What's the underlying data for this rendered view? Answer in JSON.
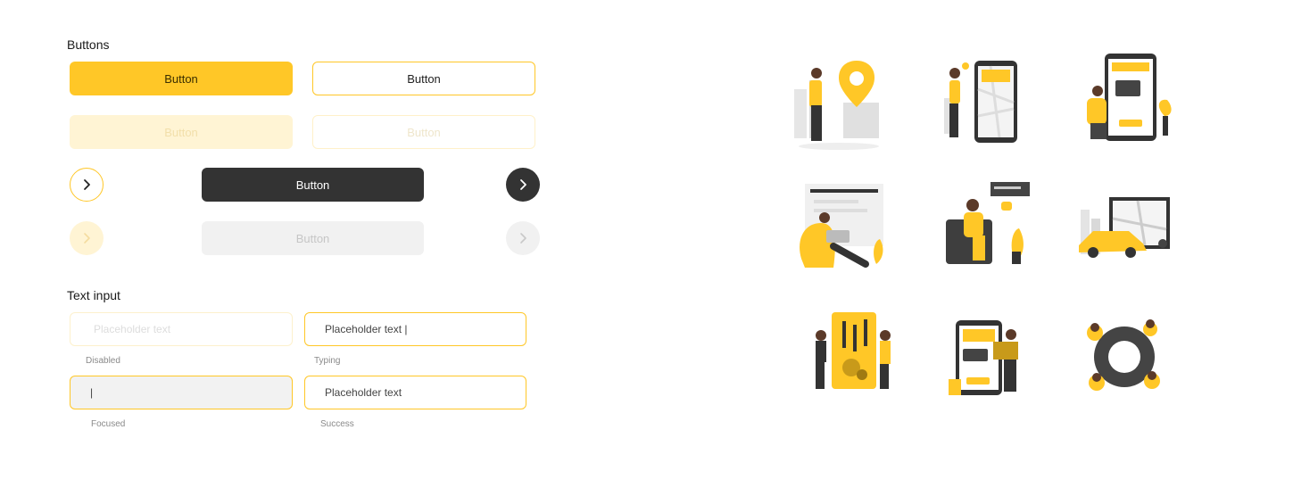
{
  "sections": {
    "buttons_title": "Buttons",
    "text_input_title": "Text input"
  },
  "buttons": {
    "primary": "Button",
    "outline": "Button",
    "primary_disabled": "Button",
    "outline_disabled": "Button",
    "dark": "Button",
    "dark_disabled": "Button"
  },
  "inputs": {
    "disabled": {
      "value": "Placeholder text",
      "caption": "Disabled"
    },
    "typing": {
      "value": "Placeholder text |",
      "caption": "Typing"
    },
    "focused": {
      "value": "|",
      "caption": "Focused"
    },
    "success": {
      "value": "Placeholder text",
      "caption": "Success"
    }
  },
  "icons": [
    "chevron-right-icon"
  ],
  "colors": {
    "accent": "#ffc727",
    "dark": "#333333",
    "disabled_light": "#fff4d4",
    "disabled_grey": "#f1f1f1"
  },
  "illustrations": [
    "location-pin-illustration",
    "mobile-map-illustration",
    "mobile-payment-illustration",
    "laptop-reading-illustration",
    "chatting-sofa-illustration",
    "taxi-map-illustration",
    "mobile-settings-illustration",
    "mobile-shopping-illustration",
    "teamwork-gear-illustration"
  ]
}
